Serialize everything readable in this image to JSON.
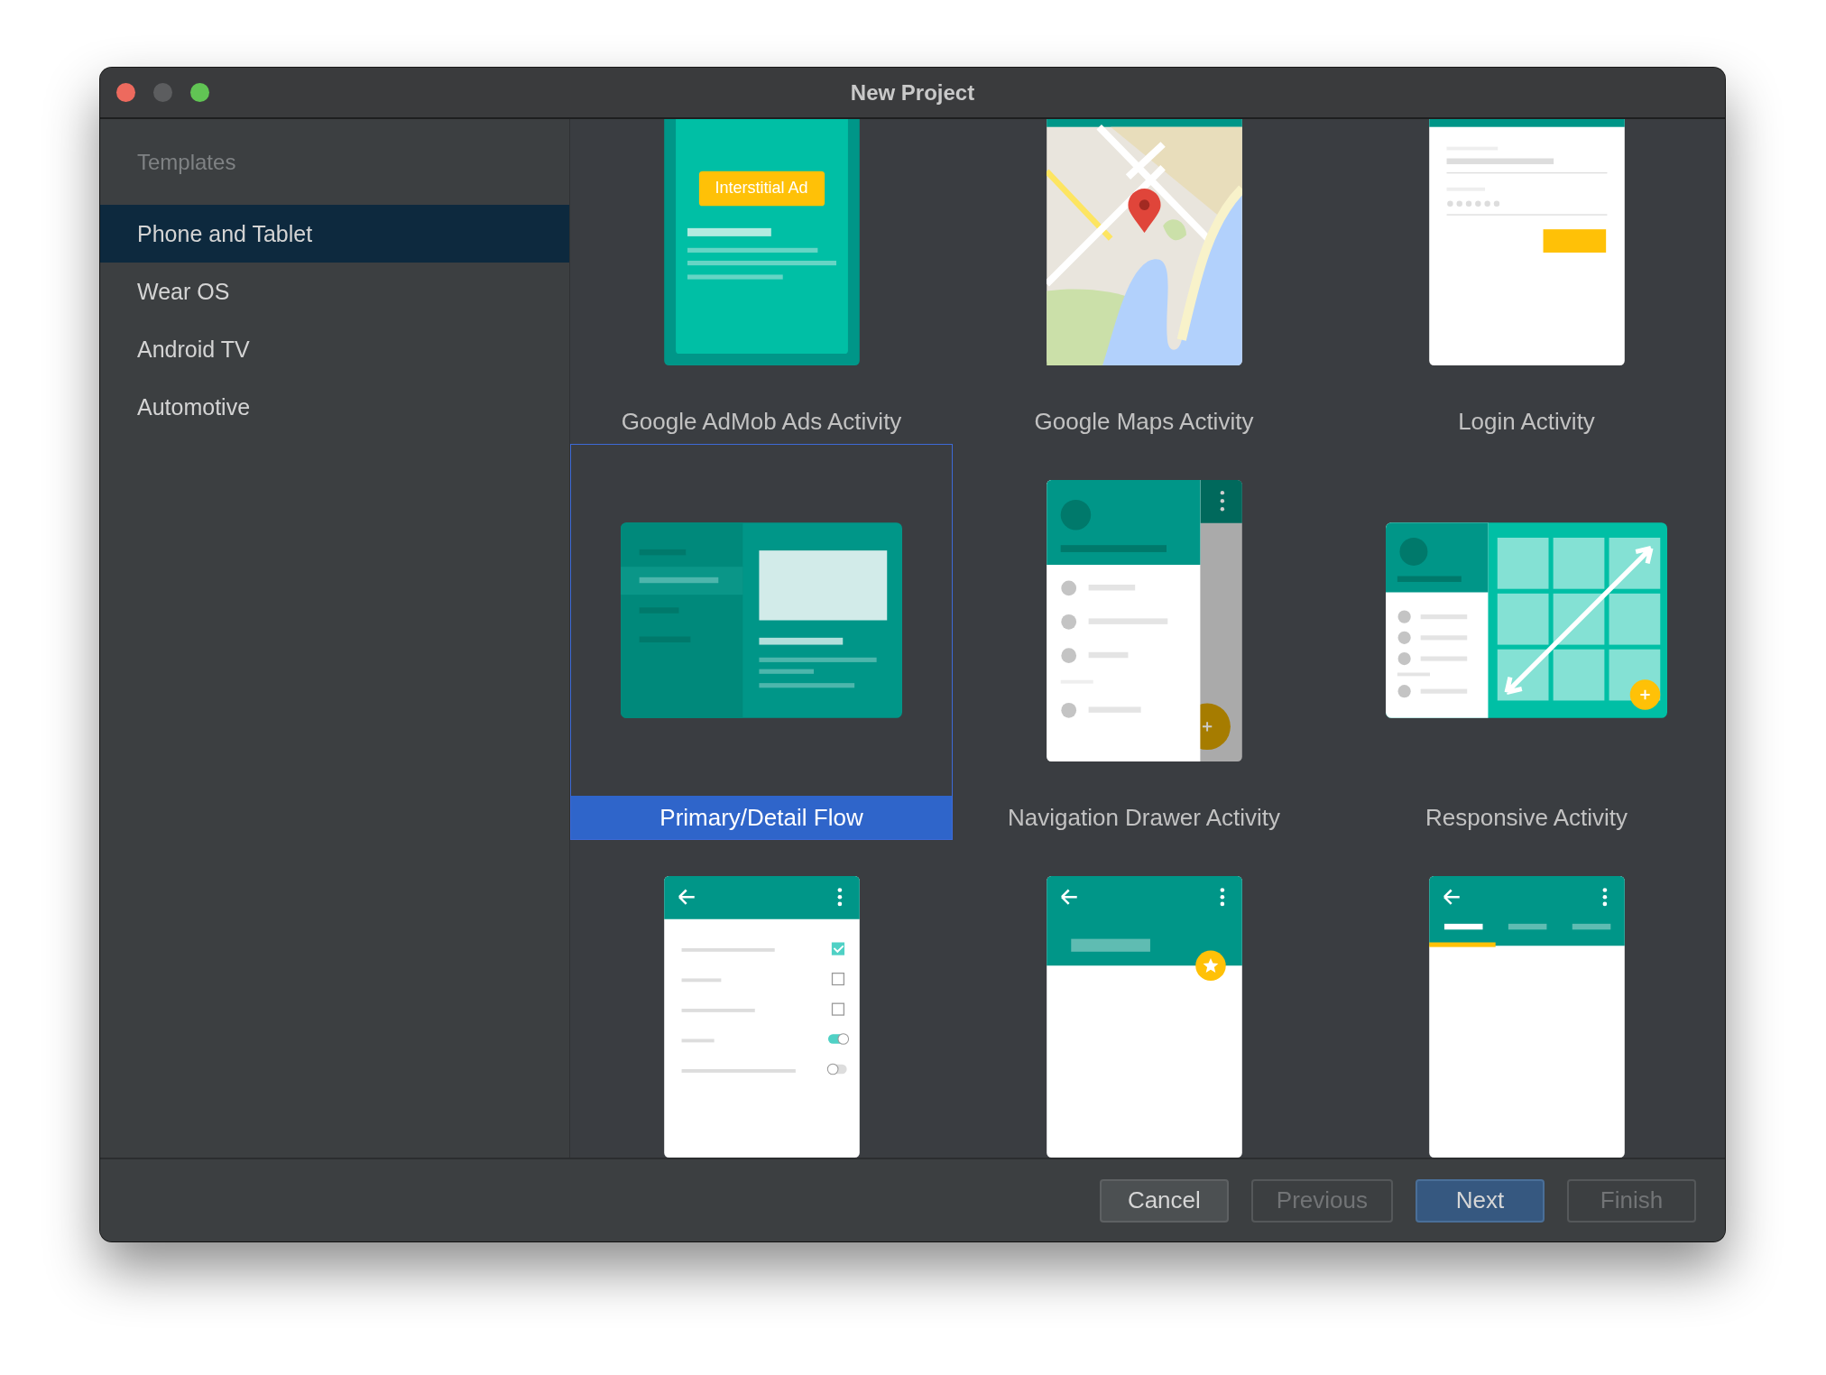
{
  "window": {
    "title": "New Project"
  },
  "sidebar": {
    "header": "Templates",
    "items": [
      {
        "label": "Phone and Tablet",
        "selected": true
      },
      {
        "label": "Wear OS",
        "selected": false
      },
      {
        "label": "Android TV",
        "selected": false
      },
      {
        "label": "Automotive",
        "selected": false
      }
    ]
  },
  "templates": [
    {
      "kind": "admob",
      "label": "Google AdMob Ads Activity",
      "badge": "Interstitial Ad",
      "selected": false
    },
    {
      "kind": "maps",
      "label": "Google Maps Activity",
      "selected": false
    },
    {
      "kind": "login",
      "label": "Login Activity",
      "selected": false
    },
    {
      "kind": "primary_detail",
      "label": "Primary/Detail Flow",
      "selected": true
    },
    {
      "kind": "nav_drawer",
      "label": "Navigation Drawer Activity",
      "selected": false
    },
    {
      "kind": "responsive",
      "label": "Responsive Activity",
      "selected": false
    },
    {
      "kind": "settings",
      "selected": false
    },
    {
      "kind": "scrolling",
      "selected": false
    },
    {
      "kind": "tabbed",
      "selected": false
    }
  ],
  "buttons": [
    {
      "label": "Cancel",
      "disabled": false,
      "default": false
    },
    {
      "label": "Previous",
      "disabled": true,
      "default": false
    },
    {
      "label": "Next",
      "disabled": false,
      "default": true
    },
    {
      "label": "Finish",
      "disabled": true,
      "default": false
    }
  ]
}
